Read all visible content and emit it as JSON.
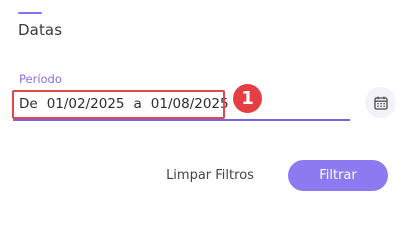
{
  "section": {
    "title": "Datas"
  },
  "period": {
    "label": "Período",
    "prefix": "De",
    "start_date": "01/02/2025",
    "separator": "a",
    "end_date": "01/08/2025"
  },
  "annotation": {
    "step_number": "1"
  },
  "actions": {
    "clear_label": "Limpar Filtros",
    "filter_label": "Filtrar"
  },
  "icons": {
    "calendar": "calendar-icon"
  },
  "colors": {
    "accent": "#8b6ff0",
    "button": "#8e7af0",
    "highlight": "#e4474b",
    "badge": "#e63e45"
  }
}
